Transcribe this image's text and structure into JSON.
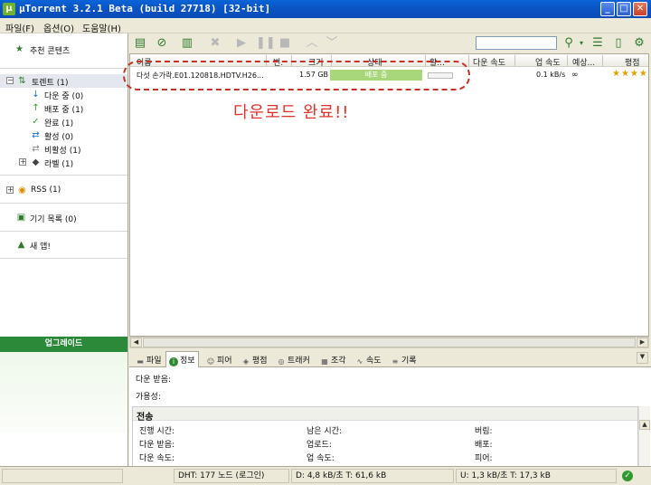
{
  "window": {
    "title": "µTorrent 3.2.1 Beta (build 27718) [32-bit]",
    "buttons": {
      "minimize": "_",
      "maximize": "□",
      "close": "✕"
    }
  },
  "menu": [
    "파일(F)",
    "옵션(O)",
    "도움말(H)"
  ],
  "sidebar": {
    "featured": "추천 콘텐츠",
    "torrents": "토렌트 (1)",
    "downloading": "다운 중 (0)",
    "seeding": "배포 중 (1)",
    "completed": "완료 (1)",
    "active": "활성 (0)",
    "inactive": "비활성 (1)",
    "labels": "라벨 (1)",
    "rss": "RSS (1)",
    "devices": "기기 목록 (0)",
    "apps": "새 앱!",
    "upgrade": "업그레이드"
  },
  "columns": {
    "name": "이름",
    "num": "번.",
    "size": "크기",
    "status": "상태",
    "health": "활...",
    "down_speed": "다운 속도",
    "up_speed": "업 속도",
    "eta": "예상...",
    "rating": "평점"
  },
  "torrents": [
    {
      "name": "다섯 손가락.E01.120818.HDTV.H26...",
      "size": "1.57 GB",
      "status": "배포 중",
      "up_speed": "0.1 kB/s",
      "eta": "∞",
      "rating": "★★★★"
    }
  ],
  "annotation": "다운로드 완료!!",
  "tabs": [
    "파일",
    "정보",
    "피어",
    "평점",
    "트래커",
    "조각",
    "속도",
    "기록"
  ],
  "detail": {
    "downloaded_label": "다운 받음:",
    "availability_label": "가용성:",
    "transfer_title": "전송",
    "time_elapsed": "진행 시간:",
    "remaining": "남은 시간:",
    "wasted": "버림:",
    "downloaded": "다운 받음:",
    "uploaded": "업로드:",
    "seeds": "배포:",
    "down_speed": "다운 속도:",
    "up_speed": "업 속도:",
    "peers": "피어:"
  },
  "status": {
    "dht": "DHT: 177 노드 (로그인)",
    "down": "D: 4,8 kB/초 T: 61,6 kB",
    "up": "U: 1,3 kB/초 T: 17,3 kB"
  },
  "colors": {
    "accent": "#2f7a2c",
    "status_seeding": "#a8d67a",
    "annotation": "#e1322b",
    "upgrade": "#2b8a3a"
  }
}
